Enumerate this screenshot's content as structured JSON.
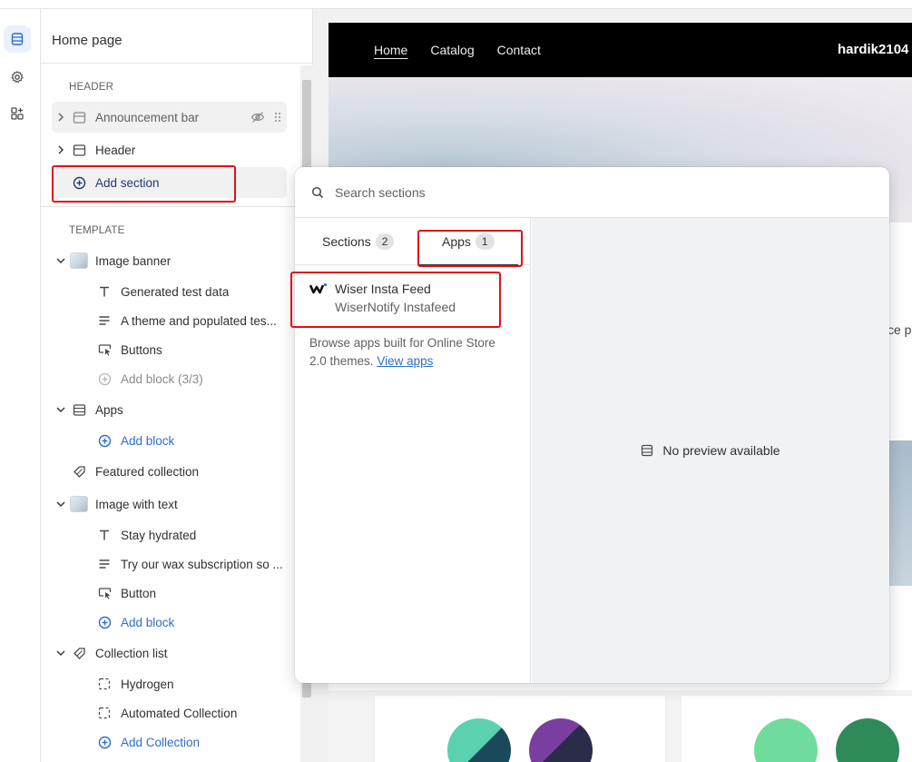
{
  "sidebar": {
    "title": "Home page",
    "header_group_label": "HEADER",
    "header_items": [
      {
        "label": "Announcement bar",
        "icon": "section-icon",
        "hidden": true
      },
      {
        "label": "Header",
        "icon": "section-icon",
        "hidden": false
      }
    ],
    "add_section_label": "Add section",
    "template_group_label": "TEMPLATE",
    "sections": [
      {
        "label": "Image banner",
        "icon": "image-thumb",
        "blocks": [
          {
            "label": "Generated test data",
            "icon": "text-icon"
          },
          {
            "label": "A theme and populated tes...",
            "icon": "paragraph-icon"
          },
          {
            "label": "Buttons",
            "icon": "button-icon"
          }
        ],
        "add_block_label": "Add block (3/3)"
      },
      {
        "label": "Apps",
        "icon": "apps-section-icon",
        "add_block_label": "Add block"
      },
      {
        "label": "Featured collection",
        "icon": "tag-icon"
      },
      {
        "label": "Image with text",
        "icon": "image-thumb",
        "blocks": [
          {
            "label": "Stay hydrated",
            "icon": "text-icon"
          },
          {
            "label": "Try our wax subscription so ...",
            "icon": "paragraph-icon"
          },
          {
            "label": "Button",
            "icon": "button-icon"
          }
        ],
        "add_block_label": "Add block"
      },
      {
        "label": "Collection list",
        "icon": "tag-icon",
        "blocks": [
          {
            "label": "Hydrogen",
            "icon": "dashed-square-icon"
          },
          {
            "label": "Automated Collection",
            "icon": "dashed-square-icon"
          }
        ],
        "add_block_label": "Add Collection"
      }
    ]
  },
  "store_preview": {
    "nav_links": [
      "Home",
      "Catalog",
      "Contact"
    ],
    "brand": "hardik2104",
    "snippet": "ce p"
  },
  "popup": {
    "search_placeholder": "Search sections",
    "tabs": [
      {
        "label": "Sections",
        "count": "2"
      },
      {
        "label": "Apps",
        "count": "1"
      }
    ],
    "active_tab": "Apps",
    "app_item": {
      "name": "Wiser Insta Feed",
      "vendor": "WiserNotify Instafeed"
    },
    "browse_text": "Browse apps built for Online Store 2.0 themes.",
    "view_apps_link": "View apps",
    "no_preview_text": "No preview available"
  },
  "colors": {
    "accent_blue": "#2c6ecb",
    "highlight_red": "#e0101a",
    "nav_black": "#000000"
  }
}
